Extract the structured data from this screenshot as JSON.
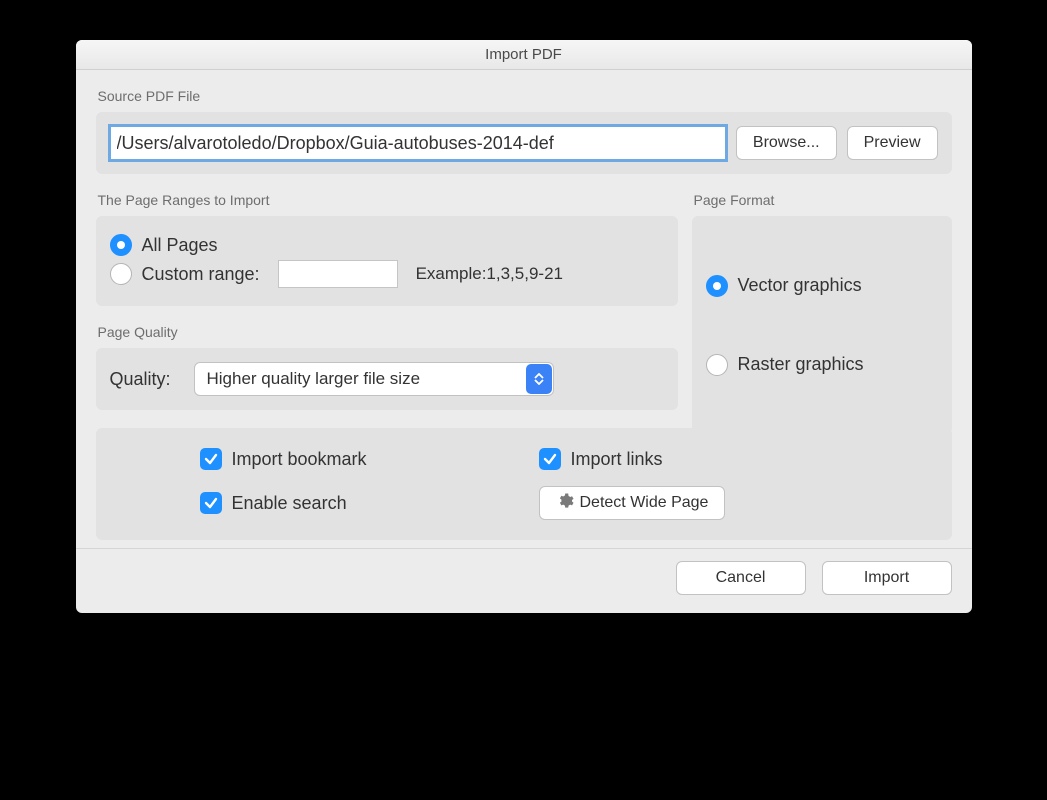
{
  "dialog": {
    "title": "Import PDF"
  },
  "source": {
    "section_label": "Source PDF File",
    "path_value": "/Users/alvarotoledo/Dropbox/Guia-autobuses-2014-def",
    "browse_label": "Browse...",
    "preview_label": "Preview"
  },
  "ranges": {
    "section_label": "The Page Ranges to Import",
    "all_label": "All Pages",
    "custom_label": "Custom range:",
    "custom_value": "",
    "example_label": "Example:1,3,5,9-21"
  },
  "quality": {
    "section_label": "Page Quality",
    "label": "Quality:",
    "selected": "Higher quality larger file size"
  },
  "format": {
    "section_label": "Page Format",
    "vector_label": "Vector graphics",
    "raster_label": "Raster graphics"
  },
  "options": {
    "bookmark_label": "Import bookmark",
    "links_label": "Import links",
    "search_label": "Enable search",
    "detect_label": "Detect Wide Page"
  },
  "footer": {
    "cancel_label": "Cancel",
    "import_label": "Import"
  }
}
